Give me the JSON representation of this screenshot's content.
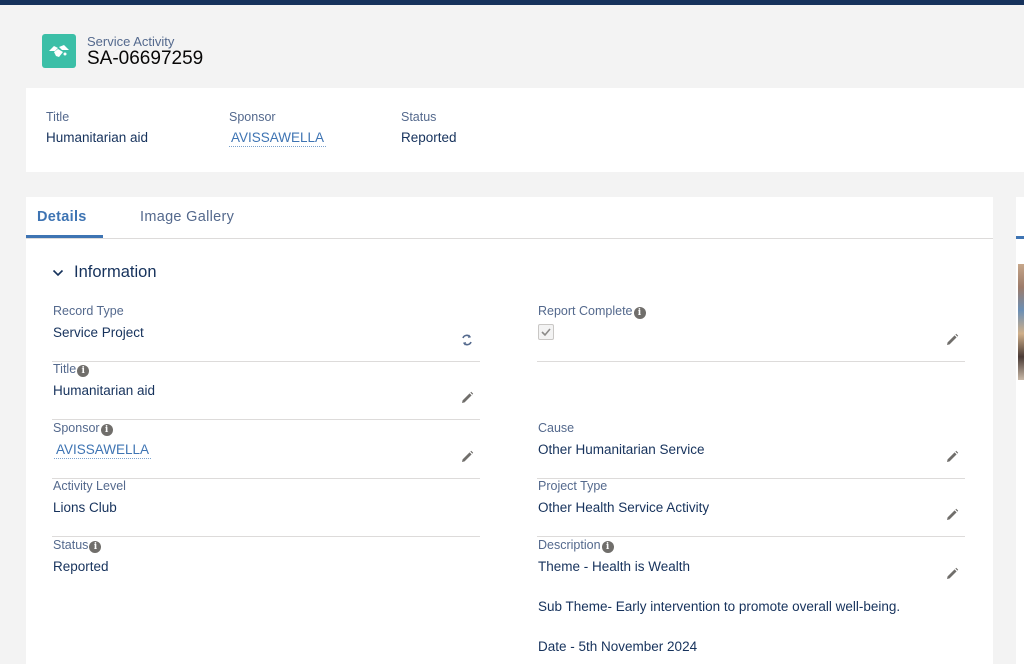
{
  "header": {
    "object_type": "Service Activity",
    "record_name": "SA-06697259",
    "icon": "handshake-icon",
    "icon_color": "#3bbfa7"
  },
  "highlights": {
    "fields": [
      {
        "label": "Title",
        "value": "Humanitarian aid"
      },
      {
        "label": "Sponsor",
        "value": "AVISSAWELLA"
      },
      {
        "label": "Status",
        "value": "Reported"
      }
    ]
  },
  "tabs": [
    {
      "label": "Details",
      "active": true
    },
    {
      "label": "Image Gallery",
      "active": false
    }
  ],
  "section": {
    "title": "Information"
  },
  "details": {
    "record_type": {
      "label": "Record Type",
      "value": "Service Project"
    },
    "title": {
      "label": "Title",
      "value": "Humanitarian aid"
    },
    "sponsor": {
      "label": "Sponsor",
      "value": "AVISSAWELLA"
    },
    "activity_level": {
      "label": "Activity Level",
      "value": "Lions Club"
    },
    "status": {
      "label": "Status",
      "value": "Reported"
    },
    "report_complete": {
      "label": "Report Complete",
      "checked": true
    },
    "cause": {
      "label": "Cause",
      "value": "Other Humanitarian Service"
    },
    "project_type": {
      "label": "Project Type",
      "value": "Other Health Service Activity"
    },
    "description": {
      "label": "Description",
      "lines": [
        "Theme - Health is Wealth",
        "Sub Theme- Early intervention to promote overall well-being.",
        "Date - 5th November 2024"
      ]
    }
  },
  "colors": {
    "accent": "#3e74b3",
    "top_bar": "#16325c"
  }
}
